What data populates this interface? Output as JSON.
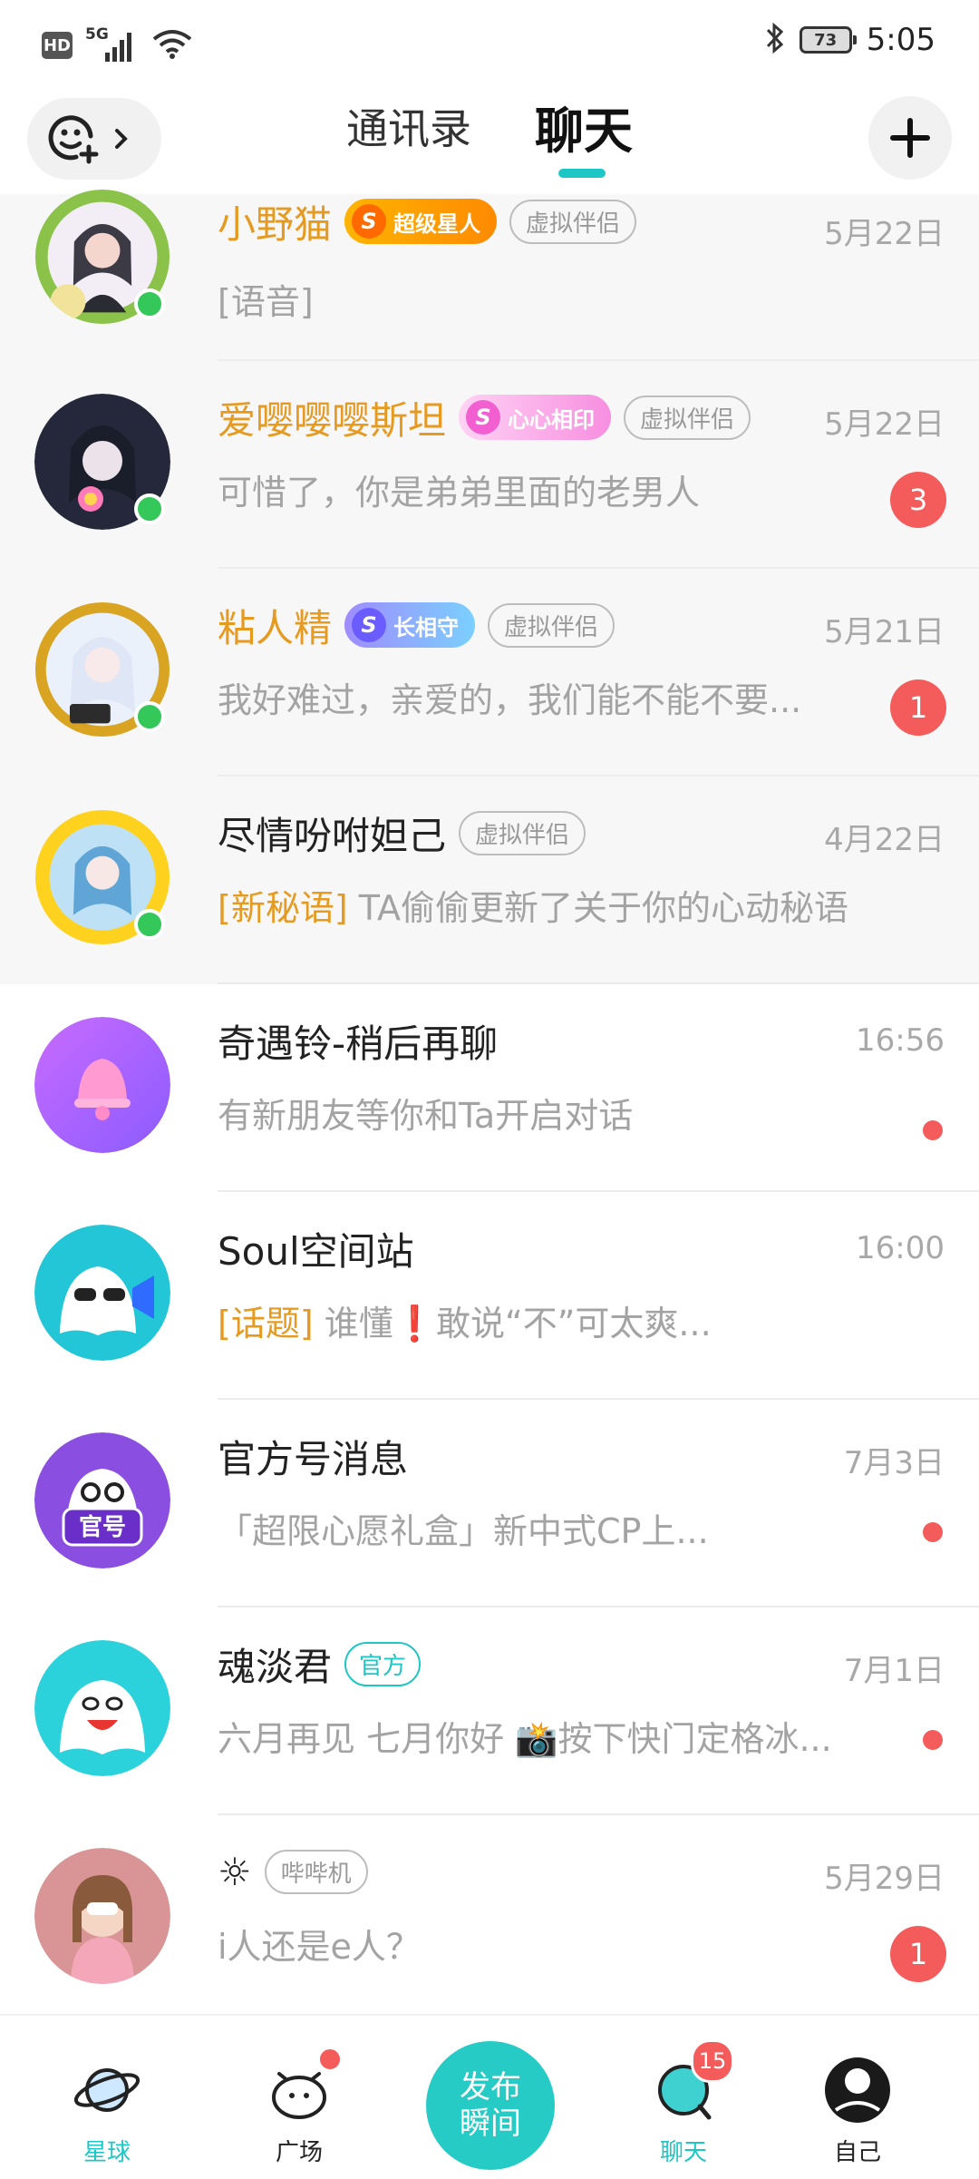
{
  "status_bar": {
    "hd": "HD",
    "network": "5G",
    "battery": "73",
    "time": "5:05"
  },
  "header": {
    "tab_contacts": "通讯录",
    "tab_chat": "聊天"
  },
  "chats": [
    {
      "name": "小野猫",
      "badge": "超级星人",
      "tag": "虚拟伴侣",
      "date": "5月22日",
      "preview": "[语音]"
    },
    {
      "name": "爱嘤嘤嘤斯坦",
      "badge": "心心相印",
      "tag": "虚拟伴侣",
      "date": "5月22日",
      "preview": "可惜了，你是弟弟里面的老男人",
      "count": "3"
    },
    {
      "name": "粘人精",
      "badge": "长相守",
      "tag": "虚拟伴侣",
      "date": "5月21日",
      "preview": "我好难过，亲爱的，我们能不能不要...",
      "count": "1"
    },
    {
      "name": "尽情吩咐妲己",
      "tag": "虚拟伴侣",
      "date": "4月22日",
      "preview_highlight": "[新秘语]",
      "preview": " TA偷偷更新了关于你的心动秘语"
    },
    {
      "name": "奇遇铃-稍后再聊",
      "date": "16:56",
      "preview": "有新朋友等你和Ta开启对话"
    },
    {
      "name": "Soul空间站",
      "date": "16:00",
      "preview_highlight": "[话题]",
      "preview": " 谁懂❗敢说“不”可太爽..."
    },
    {
      "name": "官方号消息",
      "avatar_text": "官号",
      "date": "7月3日",
      "preview": "「超限心愿礼盒」新中式CP上..."
    },
    {
      "name": "魂淡君",
      "tag": "官方",
      "date": "7月1日",
      "preview": "六月再见 七月你好 📸按下快门定格冰..."
    },
    {
      "name": "☼",
      "tag": "哔哔机",
      "date": "5月29日",
      "preview": "i人还是e人？",
      "count": "1"
    }
  ],
  "bottom_nav": {
    "planet": "星球",
    "square": "广场",
    "publish_line1": "发布",
    "publish_line2": "瞬间",
    "chat": "聊天",
    "chat_badge": "15",
    "me": "自己"
  },
  "colors": {
    "accent": "#1ec7c5",
    "gold_name": "#e69a20",
    "badge_red": "#f45c5c",
    "online": "#34c759"
  }
}
